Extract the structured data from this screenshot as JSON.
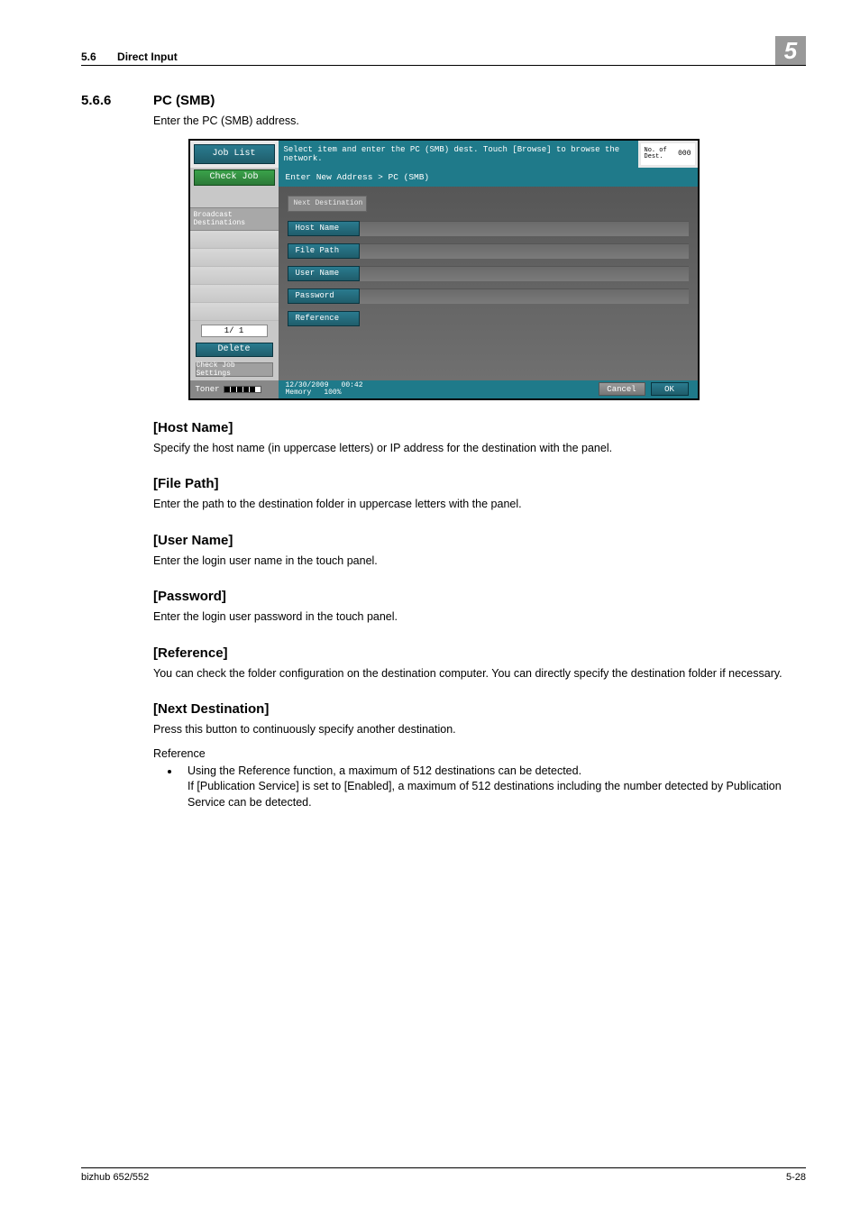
{
  "header": {
    "section_num": "5.6",
    "section_title": "Direct Input",
    "chapter_badge": "5"
  },
  "section": {
    "num": "5.6.6",
    "title": "PC (SMB)",
    "intro": "Enter the PC (SMB) address."
  },
  "panel": {
    "job_list": "Job List",
    "top_message": "Select item and enter the PC (SMB) dest. Touch [Browse] to browse the network.",
    "counter_label": "No. of Dest.",
    "counter_value": "000",
    "check_job": "Check Job",
    "broadcast": "Broadcast Destinations",
    "pager": "1/  1",
    "delete": "Delete",
    "check_job_settings": "Check Job Settings",
    "breadcrumb": "Enter New Address > PC (SMB)",
    "next_destination": "Next Destination",
    "fields": {
      "host_name": "Host Name",
      "file_path": "File Path",
      "user_name": "User Name",
      "password": "Password",
      "reference": "Reference"
    },
    "toner_label": "Toner",
    "date": "12/30/2009",
    "time": "00:42",
    "memory_label": "Memory",
    "memory_value": "100%",
    "cancel": "Cancel",
    "ok": "OK"
  },
  "subs": {
    "host_name": {
      "h": "[Host Name]",
      "p": "Specify the host name (in uppercase letters) or IP address for the destination with the panel."
    },
    "file_path": {
      "h": "[File Path]",
      "p": "Enter the path to the destination folder in uppercase letters with the panel."
    },
    "user_name": {
      "h": "[User Name]",
      "p": "Enter the login user name in the touch panel."
    },
    "password": {
      "h": "[Password]",
      "p": "Enter the login user password in the touch panel."
    },
    "reference": {
      "h": "[Reference]",
      "p": "You can check the folder configuration on the destination computer. You can directly specify the destination folder if necessary."
    },
    "next_dest": {
      "h": "[Next Destination]",
      "p": "Press this button to continuously specify another destination.",
      "ref_label": "Reference",
      "bullet1": "Using the Reference function, a maximum of 512 destinations can be detected.",
      "bullet1b": "If [Publication Service] is set to [Enabled], a maximum of 512 destinations including the number detected by Publication Service can be detected."
    }
  },
  "footer": {
    "left": "bizhub 652/552",
    "right": "5-28"
  }
}
